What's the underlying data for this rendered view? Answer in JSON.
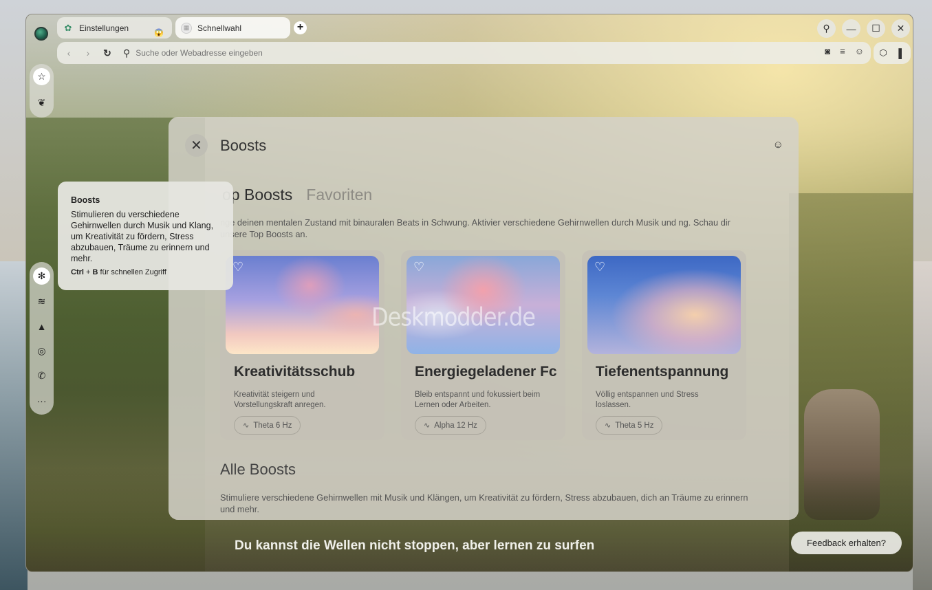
{
  "tabs": [
    {
      "label": "Einstellungen",
      "icon": "gear-icon"
    },
    {
      "label": "Schnellwahl",
      "icon": "speed-dial-icon"
    }
  ],
  "address_bar": {
    "placeholder": "Suche oder Webadresse eingeben"
  },
  "tooltip": {
    "title": "Boosts",
    "body": "Stimulieren du verschiedene Gehirnwellen durch Musik und Klang, um Kreativität zu fördern, Stress abzubauen, Träume zu erinnern und mehr.",
    "shortcut_ctrl": "Ctrl",
    "shortcut_plus": " + ",
    "shortcut_key": "B",
    "shortcut_text": " für schnellen Zugriff"
  },
  "panel": {
    "title": "Boosts",
    "tab_top": "op Boosts",
    "tab_fav": "Favoriten",
    "top_desc": "nge deinen mentalen Zustand mit binauralen Beats in Schwung. Aktivier verschiedene Gehirnwellen durch Musik und ng. Schau dir unsere Top Boosts an.",
    "cards": [
      {
        "name": "Kreativitätsschub",
        "desc": "Kreativität steigern und Vorstellungskraft anregen.",
        "wave": "Theta 6 Hz"
      },
      {
        "name": "Energiegeladener Fc",
        "desc": "Bleib entspannt und fokussiert beim Lernen oder Arbeiten.",
        "wave": "Alpha 12 Hz"
      },
      {
        "name": "Tiefenentspannung",
        "desc": "Völlig entspannen und Stress loslassen.",
        "wave": "Theta 5 Hz"
      }
    ],
    "all_title": "Alle Boosts",
    "all_desc": "Stimuliere verschiedene Gehirnwellen mit Musik und Klängen, um Kreativität zu fördern, Stress abzubauen, dich an Träume zu erinnern und mehr."
  },
  "watermark": "Deskmodder.de",
  "slogan": "Du kannst die Wellen nicht stoppen, aber lernen zu surfen",
  "feedback_button": "Feedback erhalten?"
}
